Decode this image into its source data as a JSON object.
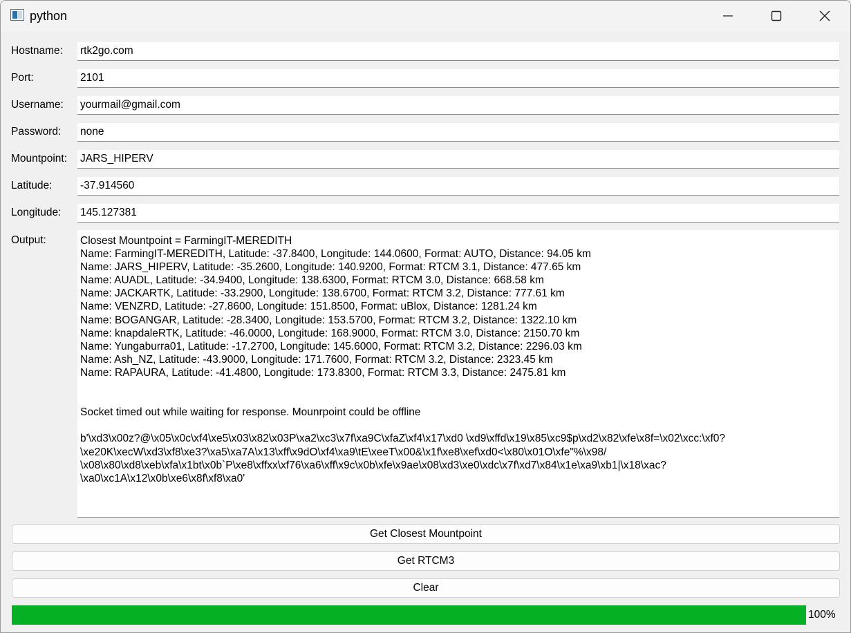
{
  "window": {
    "title": "python",
    "icons": {
      "app": "python-app-icon",
      "minimize": "minimize-icon",
      "maximize": "maximize-icon",
      "close": "close-icon"
    }
  },
  "form": {
    "hostname": {
      "label": "Hostname:",
      "value": "rtk2go.com"
    },
    "port": {
      "label": "Port:",
      "value": "2101"
    },
    "username": {
      "label": "Username:",
      "value": "yourmail@gmail.com"
    },
    "password": {
      "label": "Password:",
      "value": "none"
    },
    "mountpoint": {
      "label": "Mountpoint:",
      "value": "JARS_HIPERV"
    },
    "latitude": {
      "label": "Latitude:",
      "value": "-37.914560"
    },
    "longitude": {
      "label": "Longitude:",
      "value": "145.127381"
    }
  },
  "output": {
    "label": "Output:",
    "lines": [
      "Closest Mountpoint = FarmingIT-MEREDITH",
      "Name: FarmingIT-MEREDITH, Latitude: -37.8400, Longitude: 144.0600, Format: AUTO, Distance: 94.05 km",
      "Name: JARS_HIPERV, Latitude: -35.2600, Longitude: 140.9200, Format: RTCM 3.1, Distance: 477.65 km",
      "Name: AUADL, Latitude: -34.9400, Longitude: 138.6300, Format: RTCM 3.0, Distance: 668.58 km",
      "Name: JACKARTK, Latitude: -33.2900, Longitude: 138.6700, Format: RTCM 3.2, Distance: 777.61 km",
      "Name: VENZRD, Latitude: -27.8600, Longitude: 151.8500, Format: uBlox, Distance: 1281.24 km",
      "Name: BOGANGAR, Latitude: -28.3400, Longitude: 153.5700, Format: RTCM 3.2, Distance: 1322.10 km",
      "Name: knapdaleRTK, Latitude: -46.0000, Longitude: 168.9000, Format: RTCM 3.0, Distance: 2150.70 km",
      "Name: Yungaburra01, Latitude: -17.2700, Longitude: 145.6000, Format: RTCM 3.2, Distance: 2296.03 km",
      "Name: Ash_NZ, Latitude: -43.9000, Longitude: 171.7600, Format: RTCM 3.2, Distance: 2323.45 km",
      "Name: RAPAURA, Latitude: -41.4800, Longitude: 173.8300, Format: RTCM 3.3, Distance: 2475.81 km",
      "",
      "",
      "Socket timed out while waiting for response. Mounrpoint could be offline",
      "",
      "b'\\xd3\\x00z?@\\x05\\x0c\\xf4\\xe5\\x03\\x82\\x03P\\xa2\\xc3\\x7f\\xa9C\\xfaZ\\xf4\\x17\\xd0 \\xd9\\xffd\\x19\\x85\\xc9$p\\xd2\\x82\\xfe\\x8f=\\x02\\xcc:\\xf0?",
      "\\xe20K\\xecW\\xd3\\xf8\\xe3?\\xa5\\xa7A\\x13\\xff\\x9dO\\xf4\\xa9\\tE\\xeeT\\x00&\\x1f\\xe8\\xef\\xd0<\\x80\\x01O\\xfe\"%\\x98/",
      "\\x08\\x80\\xd8\\xeb\\xfa\\x1bt\\x0b`P\\xe8\\xffxx\\xf76\\xa6\\xff\\x9c\\x0b\\xfe\\x9ae\\x08\\xd3\\xe0\\xdc\\x7f\\xd7\\x84\\x1e\\xa9\\xb1|\\x18\\xac?",
      "\\xa0\\xc1A\\x12\\x0b\\xe6\\x8f\\xf8\\xa0'"
    ]
  },
  "buttons": {
    "get_closest": "Get Closest Mountpoint",
    "get_rtcm3": "Get RTCM3",
    "clear": "Clear"
  },
  "progress": {
    "value_percent": 100,
    "text": "100%",
    "fill_color": "#06b025"
  }
}
